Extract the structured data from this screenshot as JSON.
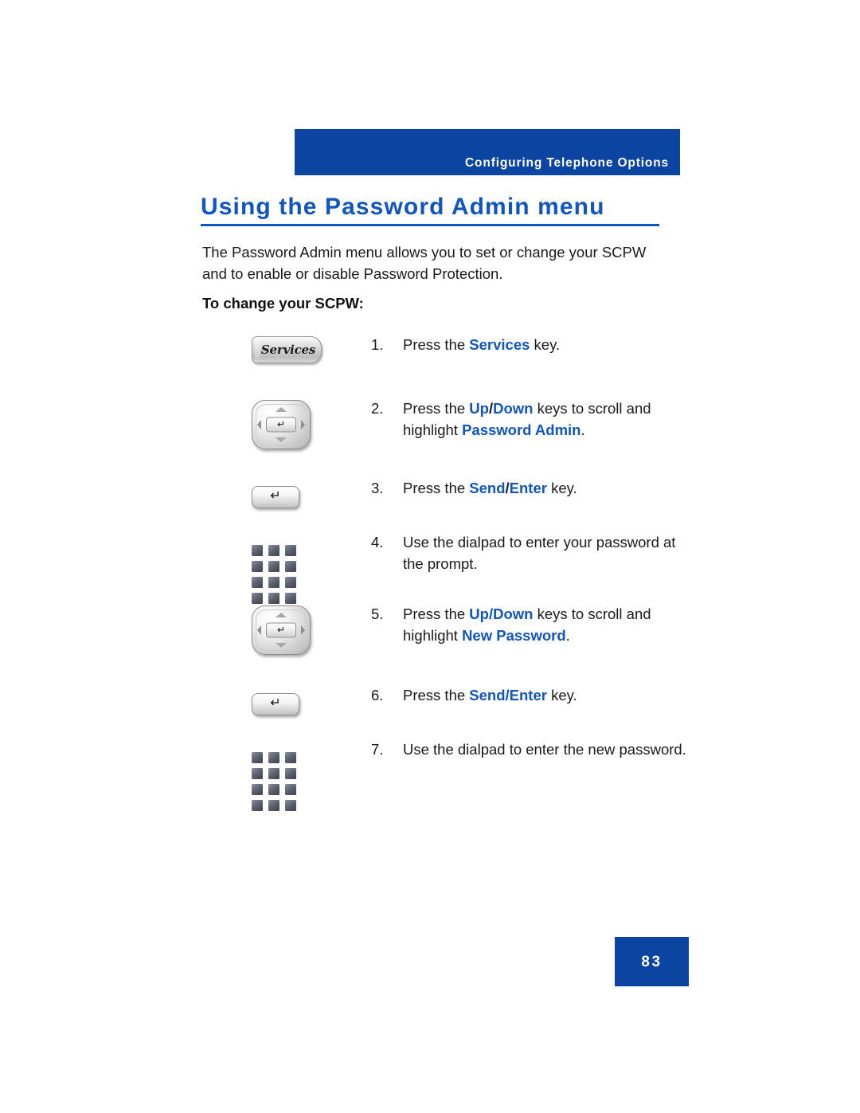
{
  "header": {
    "running_head": "Configuring Telephone Options",
    "bar_color": "#0B45A1",
    "text_color": "#FFFFFF"
  },
  "title": {
    "text": "Using the Password Admin menu",
    "color": "#1155BE"
  },
  "intro": {
    "paragraph": "The Password Admin menu allows you to set or change your SCPW and to enable or disable Password Protection."
  },
  "subheading": {
    "text": "To change your SCPW:"
  },
  "steps": [
    {
      "number": "1.",
      "icon": "services-key-icon",
      "icon_label": "Services",
      "segments": [
        {
          "text": "Press the ",
          "style": "plain"
        },
        {
          "text": "Services",
          "style": "keyword"
        },
        {
          "text": " key.",
          "style": "plain"
        }
      ]
    },
    {
      "number": "2.",
      "icon": "navigation-cluster-icon",
      "icon_label": "",
      "segments": [
        {
          "text": "Press the ",
          "style": "plain"
        },
        {
          "text": "Up",
          "style": "keyword"
        },
        {
          "text": "/",
          "style": "plain-bold"
        },
        {
          "text": "Down",
          "style": "keyword"
        },
        {
          "text": " keys to scroll and highlight ",
          "style": "plain"
        },
        {
          "text": "Password Admin",
          "style": "keyword"
        },
        {
          "text": ".",
          "style": "plain"
        }
      ]
    },
    {
      "number": "3.",
      "icon": "send-enter-key-icon",
      "icon_label": "",
      "segments": [
        {
          "text": "Press the ",
          "style": "plain"
        },
        {
          "text": "Send",
          "style": "keyword"
        },
        {
          "text": "/",
          "style": "plain-bold"
        },
        {
          "text": "Enter",
          "style": "keyword"
        },
        {
          "text": " key.",
          "style": "plain"
        }
      ]
    },
    {
      "number": "4.",
      "icon": "dialpad-icon",
      "icon_label": "",
      "segments": [
        {
          "text": "Use the dialpad to enter your password at the prompt.",
          "style": "plain"
        }
      ]
    },
    {
      "number": "5.",
      "icon": "navigation-cluster-icon",
      "icon_label": "",
      "segments": [
        {
          "text": "Press the ",
          "style": "plain"
        },
        {
          "text": "Up/Down",
          "style": "keyword"
        },
        {
          "text": " keys to scroll and highlight ",
          "style": "plain"
        },
        {
          "text": "New Password",
          "style": "keyword"
        },
        {
          "text": ".",
          "style": "plain"
        }
      ]
    },
    {
      "number": "6.",
      "icon": "send-enter-key-icon",
      "icon_label": "",
      "segments": [
        {
          "text": "Press the ",
          "style": "plain"
        },
        {
          "text": "Send/Enter",
          "style": "keyword"
        },
        {
          "text": " key.",
          "style": "plain"
        }
      ]
    },
    {
      "number": "7.",
      "icon": "dialpad-icon",
      "icon_label": "",
      "segments": [
        {
          "text": "Use the dialpad to enter the new password.",
          "style": "plain"
        }
      ]
    }
  ],
  "footer": {
    "page_number": "83",
    "box_color": "#0B45A1"
  },
  "glyphs": {
    "enter_arrow": "↵",
    "services_label": "Services"
  }
}
